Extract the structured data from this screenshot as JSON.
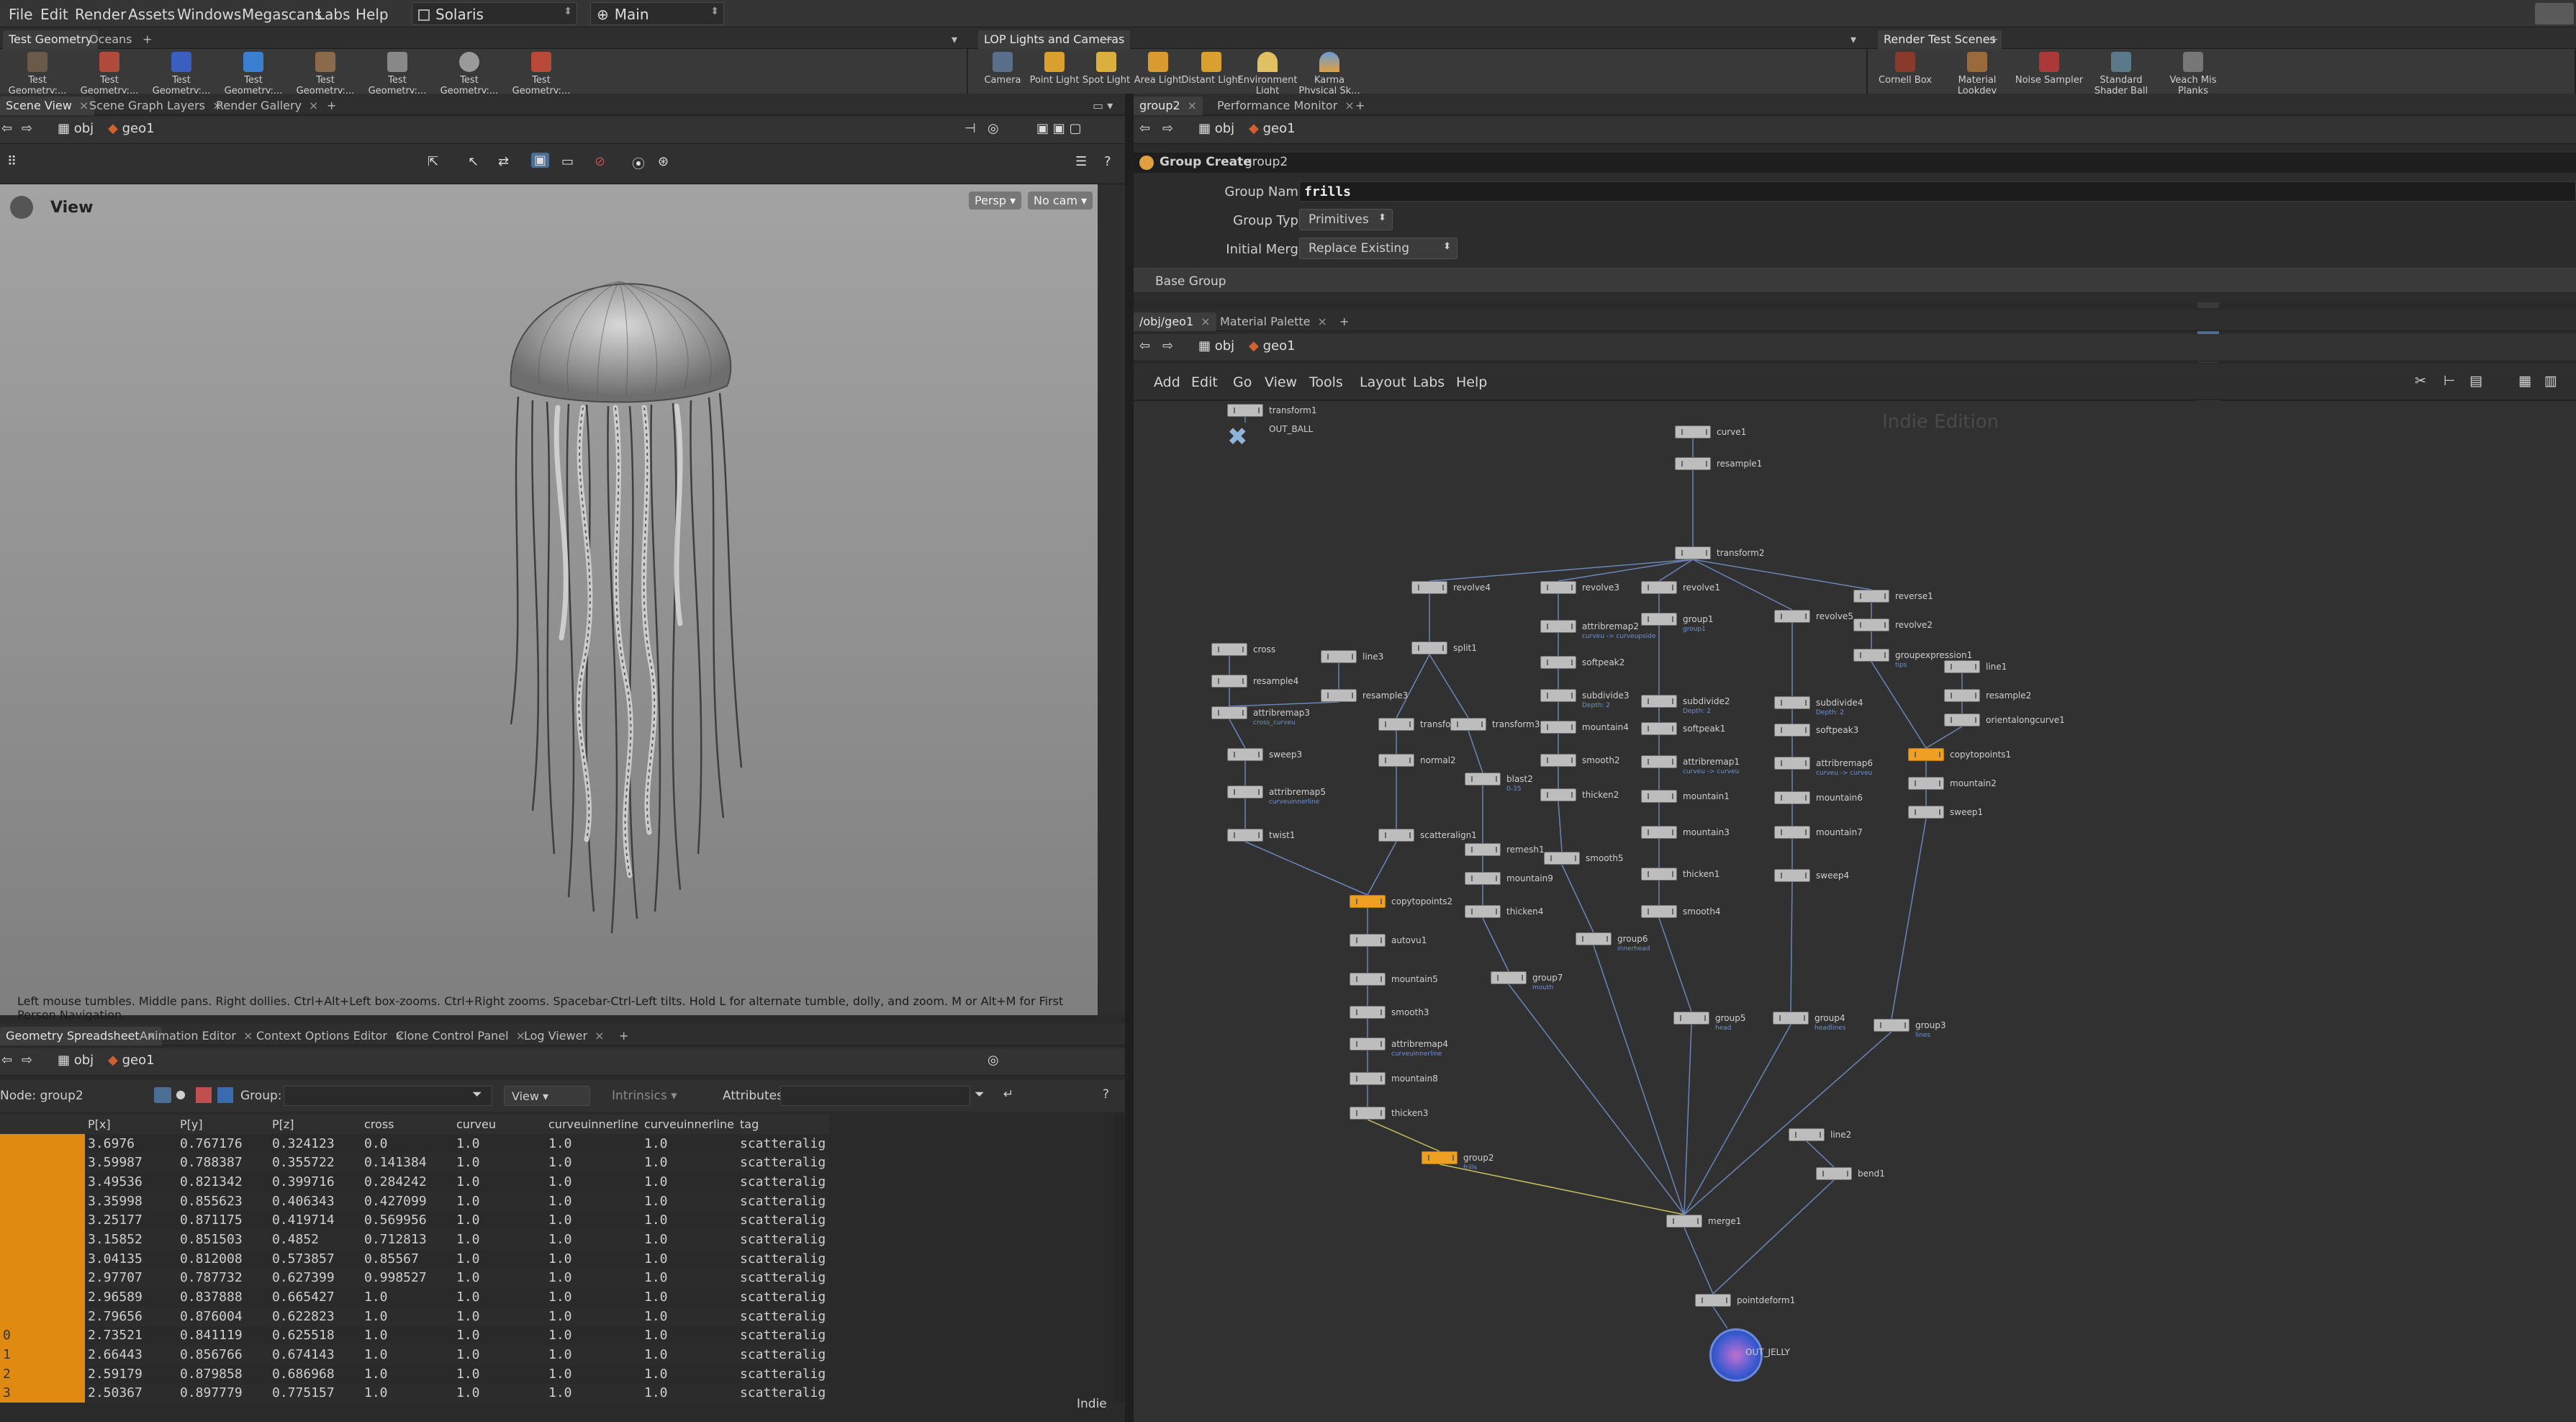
{
  "menubar": {
    "items": [
      "File",
      "Edit",
      "Render",
      "Assets",
      "Windows",
      "Megascans",
      "Labs",
      "Help"
    ],
    "desktop": "Solaris",
    "context": "Main"
  },
  "shelf_left": {
    "tabs": [
      "Test Geometry",
      "Oceans"
    ],
    "tools": [
      "Test Geometry:...",
      "Test Geometry:...",
      "Test Geometry:...",
      "Test Geometry:...",
      "Test Geometry:...",
      "Test Geometry:...",
      "Test Geometry:...",
      "Test Geometry:..."
    ]
  },
  "shelf_mid": {
    "tab": "LOP Lights and Cameras",
    "tools": [
      "Camera",
      "Point Light",
      "Spot Light",
      "Area Light",
      "Distant Light",
      "Environment Light",
      "Karma Physical Sk..."
    ]
  },
  "shelf_right": {
    "tab": "Render Test Scenes",
    "tools": [
      "Cornell Box",
      "Material Lookdev",
      "Noise Sampler",
      "Standard Shader Ball",
      "Veach Mis Planks"
    ]
  },
  "left_tabs": [
    "Scene View",
    "Scene Graph Layers",
    "Render Gallery"
  ],
  "left_path": {
    "root": "obj",
    "node": "geo1"
  },
  "viewport": {
    "title": "View",
    "cam_mode": "Persp",
    "camera": "No cam",
    "hint": "Left mouse tumbles. Middle pans. Right dollies. Ctrl+Alt+Left box-zooms. Ctrl+Right zooms. Spacebar-Ctrl-Left tilts. Hold L for alternate tumble, dolly, and zoom. M or Alt+M for First Person Navigation."
  },
  "bottom_tabs": [
    "Geometry Spreadsheet",
    "Animation Editor",
    "Context Options Editor",
    "Clone Control Panel",
    "Log Viewer"
  ],
  "spreadsheet": {
    "node_label": "Node: group2",
    "group_label": "Group:",
    "view_label": "View",
    "intrinsics_label": "Intrinsics",
    "attributes_label": "Attributes:",
    "edition": "Indie",
    "columns": [
      "P[x]",
      "P[y]",
      "P[z]",
      "cross",
      "curveu",
      "curveuinnerline",
      "curveuinnerline",
      "tag"
    ],
    "rows": [
      [
        "",
        "3.6976",
        "0.767176",
        "0.324123",
        "0.0",
        "1.0",
        "1.0",
        "1.0",
        "scatteralig"
      ],
      [
        "",
        "3.59987",
        "0.788387",
        "0.355722",
        "0.141384",
        "1.0",
        "1.0",
        "1.0",
        "scatteralig"
      ],
      [
        "",
        "3.49536",
        "0.821342",
        "0.399716",
        "0.284242",
        "1.0",
        "1.0",
        "1.0",
        "scatteralig"
      ],
      [
        "",
        "3.35998",
        "0.855623",
        "0.406343",
        "0.427099",
        "1.0",
        "1.0",
        "1.0",
        "scatteralig"
      ],
      [
        "",
        "3.25177",
        "0.871175",
        "0.419714",
        "0.569956",
        "1.0",
        "1.0",
        "1.0",
        "scatteralig"
      ],
      [
        "",
        "3.15852",
        "0.851503",
        "0.4852",
        "0.712813",
        "1.0",
        "1.0",
        "1.0",
        "scatteralig"
      ],
      [
        "",
        "3.04135",
        "0.812008",
        "0.573857",
        "0.85567",
        "1.0",
        "1.0",
        "1.0",
        "scatteralig"
      ],
      [
        "",
        "2.97707",
        "0.787732",
        "0.627399",
        "0.998527",
        "1.0",
        "1.0",
        "1.0",
        "scatteralig"
      ],
      [
        "",
        "2.96589",
        "0.837888",
        "0.665427",
        "1.0",
        "1.0",
        "1.0",
        "1.0",
        "scatteralig"
      ],
      [
        "",
        "2.79656",
        "0.876004",
        "0.622823",
        "1.0",
        "1.0",
        "1.0",
        "1.0",
        "scatteralig"
      ],
      [
        "0",
        "2.73521",
        "0.841119",
        "0.625518",
        "1.0",
        "1.0",
        "1.0",
        "1.0",
        "scatteralig"
      ],
      [
        "1",
        "2.66443",
        "0.856766",
        "0.674143",
        "1.0",
        "1.0",
        "1.0",
        "1.0",
        "scatteralig"
      ],
      [
        "2",
        "2.59179",
        "0.879858",
        "0.686968",
        "1.0",
        "1.0",
        "1.0",
        "1.0",
        "scatteralig"
      ],
      [
        "3",
        "2.50367",
        "0.897779",
        "0.775157",
        "1.0",
        "1.0",
        "1.0",
        "1.0",
        "scatteralig"
      ]
    ]
  },
  "param_tabs": [
    "group2",
    "Performance Monitor"
  ],
  "params": {
    "path_root": "obj",
    "path_node": "geo1",
    "node_type": "Group Create",
    "node_name": "group2",
    "group_name_label": "Group Name",
    "group_name": "frills",
    "group_type_label": "Group Type",
    "group_type": "Primitives",
    "initial_merge_label": "Initial Merge",
    "initial_merge": "Replace Existing",
    "base_group": "Base Group"
  },
  "net_tabs": [
    "/obj/geo1",
    "Material Palette"
  ],
  "network": {
    "path_root": "obj",
    "path_node": "geo1",
    "menu": [
      "Add",
      "Edit",
      "Go",
      "View",
      "Tools",
      "Layout",
      "Labs",
      "Help"
    ],
    "watermark": "Indie Edition",
    "nodes": [
      {
        "n": "transform1",
        "s": ""
      },
      {
        "n": "OUT_BALL",
        "s": ""
      },
      {
        "n": "curve1",
        "s": ""
      },
      {
        "n": "resample1",
        "s": ""
      },
      {
        "n": "transform2",
        "s": ""
      },
      {
        "n": "revolve4",
        "s": ""
      },
      {
        "n": "revolve3",
        "s": ""
      },
      {
        "n": "revolve1",
        "s": ""
      },
      {
        "n": "revolve5",
        "s": ""
      },
      {
        "n": "reverse1",
        "s": ""
      },
      {
        "n": "revolve2",
        "s": ""
      },
      {
        "n": "attribremap2",
        "s": "curveu -> curveupside"
      },
      {
        "n": "group1",
        "s": "group1"
      },
      {
        "n": "groupexpression1",
        "s": "tips"
      },
      {
        "n": "cross",
        "s": ""
      },
      {
        "n": "line3",
        "s": ""
      },
      {
        "n": "resample4",
        "s": ""
      },
      {
        "n": "split1",
        "s": ""
      },
      {
        "n": "softpeak2",
        "s": ""
      },
      {
        "n": "line1",
        "s": ""
      },
      {
        "n": "resample3",
        "s": ""
      },
      {
        "n": "resample2",
        "s": ""
      },
      {
        "n": "attribremap3",
        "s": "cross_curveu"
      },
      {
        "n": "subdivide3",
        "s": "Depth: 2"
      },
      {
        "n": "subdivide2",
        "s": "Depth: 2"
      },
      {
        "n": "subdivide4",
        "s": "Depth: 2"
      },
      {
        "n": "orientalongcurve1",
        "s": ""
      },
      {
        "n": "transform4",
        "s": ""
      },
      {
        "n": "transform3",
        "s": ""
      },
      {
        "n": "mountain4",
        "s": ""
      },
      {
        "n": "softpeak1",
        "s": ""
      },
      {
        "n": "softpeak3",
        "s": ""
      },
      {
        "n": "sweep3",
        "s": ""
      },
      {
        "n": "normal2",
        "s": ""
      },
      {
        "n": "smooth2",
        "s": ""
      },
      {
        "n": "attribremap1",
        "s": "curveu -> curveu"
      },
      {
        "n": "attribremap6",
        "s": "curveu -> curveu"
      },
      {
        "n": "copytopoints1",
        "s": ""
      },
      {
        "n": "blast2",
        "s": "0-35"
      },
      {
        "n": "mountain2",
        "s": ""
      },
      {
        "n": "attribremap5",
        "s": "curveuinnerline"
      },
      {
        "n": "thicken2",
        "s": ""
      },
      {
        "n": "mountain1",
        "s": ""
      },
      {
        "n": "mountain6",
        "s": ""
      },
      {
        "n": "sweep1",
        "s": ""
      },
      {
        "n": "twist1",
        "s": ""
      },
      {
        "n": "scatteralign1",
        "s": ""
      },
      {
        "n": "mountain3",
        "s": ""
      },
      {
        "n": "mountain7",
        "s": ""
      },
      {
        "n": "remesh1",
        "s": ""
      },
      {
        "n": "smooth5",
        "s": ""
      },
      {
        "n": "mountain9",
        "s": ""
      },
      {
        "n": "thicken1",
        "s": ""
      },
      {
        "n": "sweep4",
        "s": ""
      },
      {
        "n": "copytopoints2",
        "s": ""
      },
      {
        "n": "thicken4",
        "s": ""
      },
      {
        "n": "smooth4",
        "s": ""
      },
      {
        "n": "autovu1",
        "s": ""
      },
      {
        "n": "group6",
        "s": "innerhead"
      },
      {
        "n": "mountain5",
        "s": ""
      },
      {
        "n": "group7",
        "s": "mouth"
      },
      {
        "n": "smooth3",
        "s": ""
      },
      {
        "n": "group5",
        "s": "head"
      },
      {
        "n": "group4",
        "s": "headlines"
      },
      {
        "n": "group3",
        "s": "lines"
      },
      {
        "n": "attribremap4",
        "s": "curveuinnerline"
      },
      {
        "n": "mountain8",
        "s": ""
      },
      {
        "n": "thicken3",
        "s": ""
      },
      {
        "n": "group2",
        "s": "frills"
      },
      {
        "n": "line2",
        "s": ""
      },
      {
        "n": "bend1",
        "s": ""
      },
      {
        "n": "merge1",
        "s": ""
      },
      {
        "n": "pointdeform1",
        "s": ""
      },
      {
        "n": "OUT_JELLY",
        "s": ""
      }
    ]
  }
}
